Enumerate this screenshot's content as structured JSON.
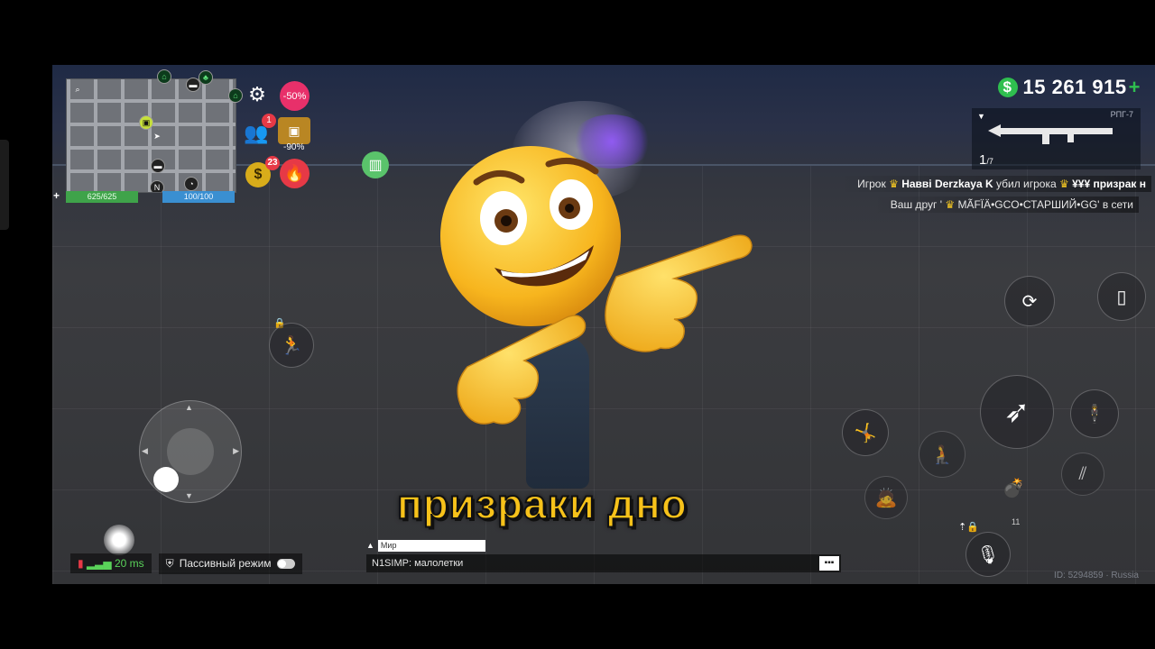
{
  "hud": {
    "money": "15 261 915",
    "money_currency_icon": "$",
    "money_plus": "+",
    "discount_badge": "-50%",
    "friends_count": "1",
    "chest_discount": "-90%",
    "shop_count": "23",
    "weapon_name": "РПГ-7",
    "ammo_current": "1",
    "ammo_total": "/7",
    "hp": "625/625",
    "armor": "100/100",
    "grenade_count": "11"
  },
  "feed": {
    "kill_line": {
      "prefix": "Игрок",
      "killer": "Навві Derzkaya K",
      "action": "убил игрока",
      "victim": "¥¥¥ призрак н"
    },
    "friend_line": {
      "prefix": "Ваш друг '",
      "friend": "MÃFÏÄ•GCO•СТАРШИЙ•GG'",
      "suffix": "в сети"
    }
  },
  "subtitle": "призраки дно",
  "status": {
    "ping": "20 ms",
    "passive_mode": "Пассивный режим"
  },
  "chat": {
    "channel": "Мир",
    "message": "N1SIMP: малолетки"
  },
  "server_id": "ID: 5294859 · Russia",
  "colors": {
    "money_green": "#2fbf4f",
    "subtitle_yellow": "#f7c21a",
    "hp_green": "#3fa34a",
    "armor_blue": "#3a8fd1",
    "badge_red": "#e63946"
  },
  "icons": [
    "search-icon",
    "settings-gear-icon",
    "friends-icon",
    "treasure-chest-icon",
    "money-bag-icon",
    "fire-icon",
    "sprint-icon",
    "phone-icon",
    "steering-wheel-icon",
    "fire-weapon-icon",
    "stand-icon",
    "jump-icon",
    "crouch-icon",
    "prone-icon",
    "grenade-icon",
    "ammo-icon",
    "microphone-icon",
    "lock-icon",
    "chat-icon"
  ]
}
